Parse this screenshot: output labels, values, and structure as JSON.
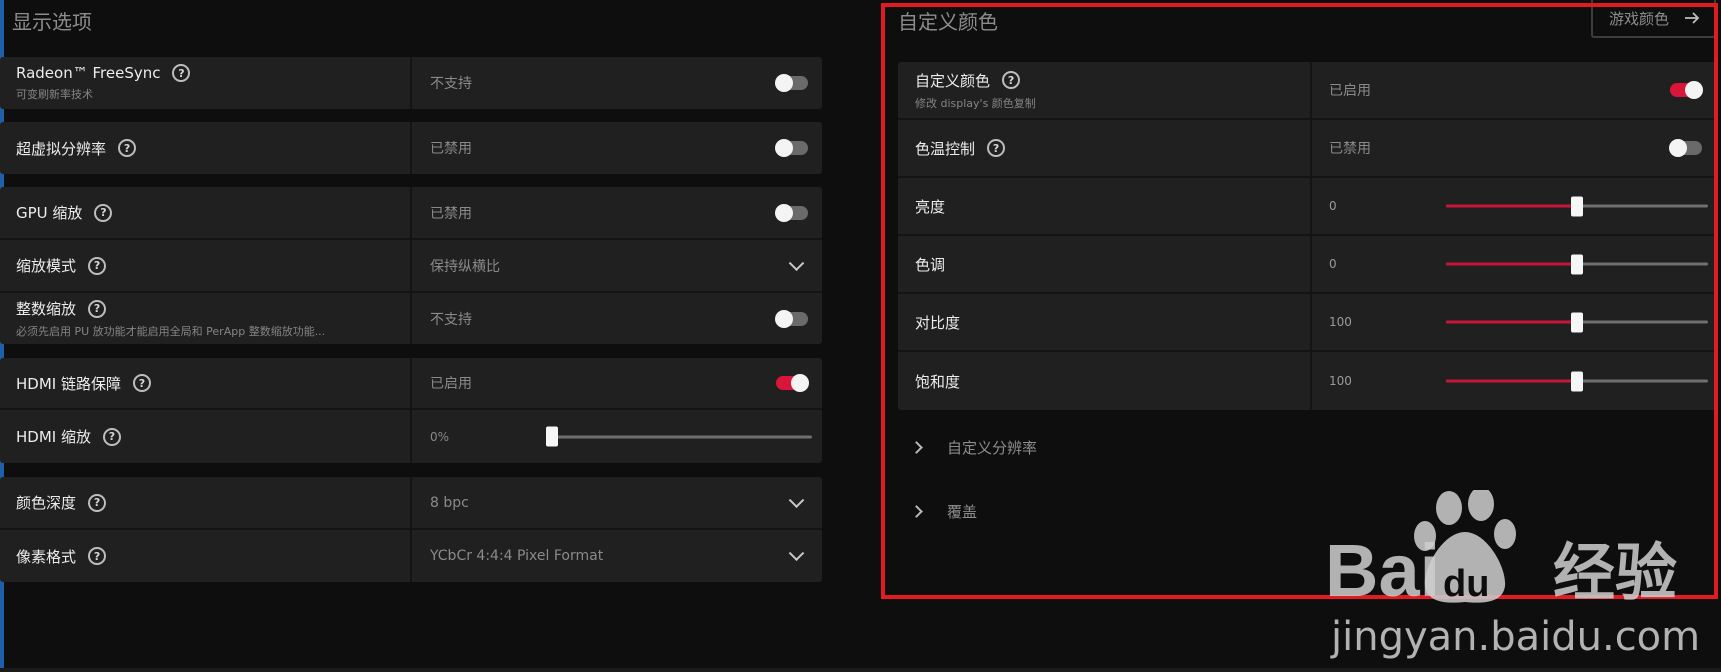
{
  "display_options": {
    "title": "显示选项",
    "groups": [
      {
        "rows": [
          {
            "label": "Radeon™ FreeSync",
            "sub": "可变刷新率技术",
            "value": "不支持",
            "control": "toggle",
            "on": false
          }
        ]
      },
      {
        "rows": [
          {
            "label": "超虚拟分辨率",
            "value": "已禁用",
            "control": "toggle",
            "on": false
          }
        ]
      },
      {
        "rows": [
          {
            "label": "GPU 缩放",
            "value": "已禁用",
            "control": "toggle",
            "on": false
          },
          {
            "label": "缩放模式",
            "value": "保持纵横比",
            "control": "dropdown"
          },
          {
            "label": "整数缩放",
            "sub": "必须先启用 PU 放功能才能启用全局和 PerApp 整数缩放功能...",
            "value": "不支持",
            "control": "toggle",
            "on": false
          }
        ]
      },
      {
        "rows": [
          {
            "label": "HDMI 链路保障",
            "value": "已启用",
            "control": "toggle",
            "on": true
          },
          {
            "label": "HDMI 缩放",
            "value": "0%",
            "control": "slider",
            "level": 0
          }
        ]
      },
      {
        "rows": [
          {
            "label": "颜色深度",
            "value": "8 bpc",
            "control": "dropdown"
          },
          {
            "label": "像素格式",
            "value": "YCbCr 4:4:4 Pixel Format",
            "control": "dropdown"
          }
        ]
      }
    ]
  },
  "custom_color": {
    "title": "自定义颜色",
    "game_color_button": "游戏颜色",
    "rows": [
      {
        "label": "自定义颜色",
        "sub": "修改 display's 颜色复制",
        "value": "已启用",
        "control": "toggle",
        "on": true
      },
      {
        "label": "色温控制",
        "value": "已禁用",
        "control": "toggle",
        "on": false
      },
      {
        "label": "亮度",
        "value": "0",
        "control": "slider",
        "level": 0.5
      },
      {
        "label": "色调",
        "value": "0",
        "control": "slider",
        "level": 0.5
      },
      {
        "label": "对比度",
        "value": "100",
        "control": "slider",
        "level": 0.5
      },
      {
        "label": "饱和度",
        "value": "100",
        "control": "slider",
        "level": 0.5
      }
    ],
    "expanders": [
      "自定义分辨率",
      "覆盖"
    ]
  },
  "watermark": {
    "brand": "Bai",
    "brand2": "经验",
    "url": "jingyan.baidu.com"
  },
  "colors": {
    "accent": "#d8163a",
    "highlight_box": "#e01b22",
    "panel": "#202020",
    "background": "#0e0e0e"
  }
}
